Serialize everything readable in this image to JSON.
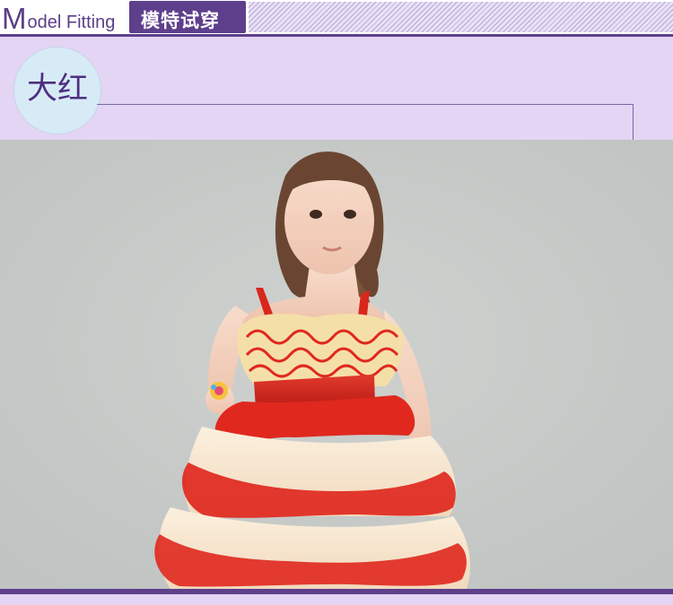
{
  "header": {
    "title_en_first": "M",
    "title_en_rest": "odel Fitting",
    "title_cn": "模特试穿"
  },
  "section": {
    "color_label": "大红"
  },
  "colors": {
    "accent": "#5e3f8c",
    "background": "#e3d5f3",
    "circle": "#d7ebf7",
    "dress_red": "#e0281e",
    "dress_cream": "#f6e4cc"
  },
  "photo": {
    "subject": "model-photo"
  }
}
